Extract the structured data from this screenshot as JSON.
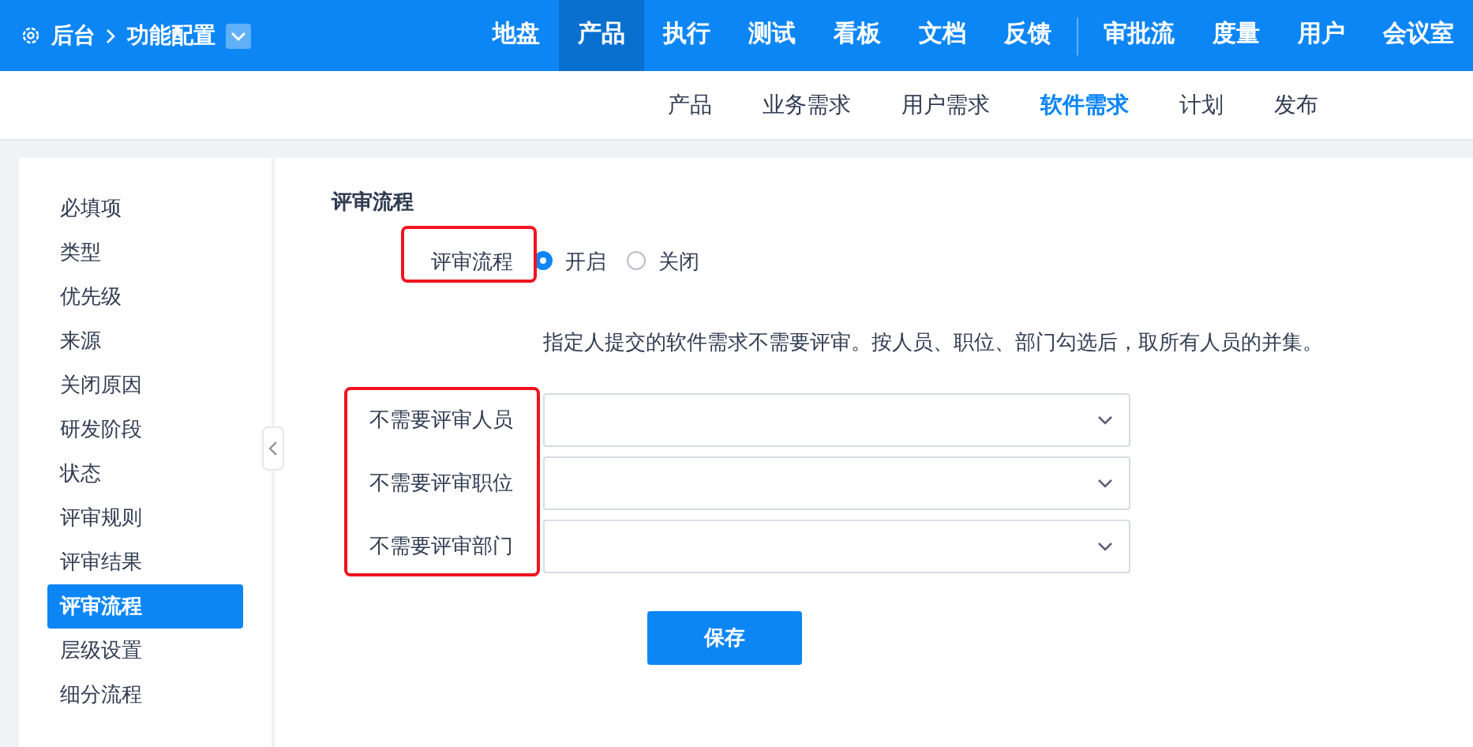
{
  "breadcrumb": {
    "home": "后台",
    "current": "功能配置"
  },
  "main_nav": [
    {
      "label": "地盘",
      "selected": false
    },
    {
      "label": "产品",
      "selected": true
    },
    {
      "label": "执行",
      "selected": false
    },
    {
      "label": "测试",
      "selected": false
    },
    {
      "label": "看板",
      "selected": false
    },
    {
      "label": "文档",
      "selected": false
    },
    {
      "label": "反馈",
      "selected": false
    }
  ],
  "extra_nav": [
    {
      "label": "审批流",
      "selected": false
    },
    {
      "label": "度量",
      "selected": false
    },
    {
      "label": "用户",
      "selected": false
    },
    {
      "label": "会议室",
      "selected": false
    }
  ],
  "sub_nav": [
    {
      "label": "产品",
      "selected": false
    },
    {
      "label": "业务需求",
      "selected": false
    },
    {
      "label": "用户需求",
      "selected": false
    },
    {
      "label": "软件需求",
      "selected": true
    },
    {
      "label": "计划",
      "selected": false
    },
    {
      "label": "发布",
      "selected": false
    }
  ],
  "sidebar": {
    "items": [
      {
        "label": "必填项",
        "selected": false
      },
      {
        "label": "类型",
        "selected": false
      },
      {
        "label": "优先级",
        "selected": false
      },
      {
        "label": "来源",
        "selected": false
      },
      {
        "label": "关闭原因",
        "selected": false
      },
      {
        "label": "研发阶段",
        "selected": false
      },
      {
        "label": "状态",
        "selected": false
      },
      {
        "label": "评审规则",
        "selected": false
      },
      {
        "label": "评审结果",
        "selected": false
      },
      {
        "label": "评审流程",
        "selected": true
      },
      {
        "label": "层级设置",
        "selected": false
      },
      {
        "label": "细分流程",
        "selected": false
      }
    ]
  },
  "form": {
    "title": "评审流程",
    "review": {
      "label": "评审流程",
      "highlighted": true,
      "options": [
        {
          "label": "开启",
          "selected": true
        },
        {
          "label": "关闭",
          "selected": false
        }
      ]
    },
    "hint": "指定人提交的软件需求不需要评审。按人员、职位、部门勾选后，取所有人员的并集。",
    "exemptions": {
      "highlighted": true,
      "fields": [
        {
          "label": "不需要评审人员"
        },
        {
          "label": "不需要评审职位"
        },
        {
          "label": "不需要评审部门"
        }
      ]
    },
    "save_button": "保存"
  }
}
